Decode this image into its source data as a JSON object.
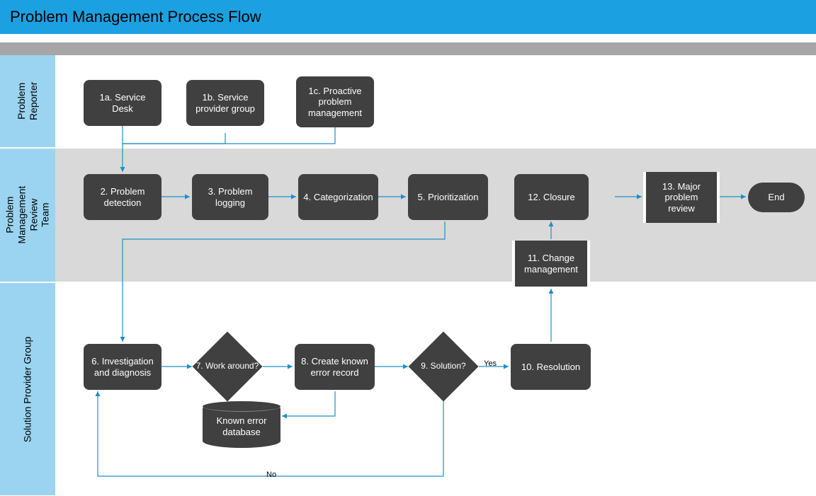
{
  "title": "Problem Management Process Flow",
  "lanes": {
    "reporter": "Problem\nReporter",
    "review": "Problem\nManagement Review\nTeam",
    "solution": "Solution Provider Group"
  },
  "nodes": {
    "n1a": "1a. Service Desk",
    "n1b": "1b. Service provider group",
    "n1c": "1c. Proactive problem management",
    "n2": "2. Problem detection",
    "n3": "3. Problem logging",
    "n4": "4. Categorization",
    "n5": "5. Prioritization",
    "n12": "12. Closure",
    "n13": "13. Major problem review",
    "end": "End",
    "n11": "11. Change management",
    "n6": "6. Investigation and diagnosis",
    "n7": "7. Work around?",
    "n8": "8. Create known error record",
    "n9": "9. Solution?",
    "n10": "10. Resolution",
    "db": "Known error database"
  },
  "edges": {
    "yes": "Yes",
    "no": "No"
  }
}
